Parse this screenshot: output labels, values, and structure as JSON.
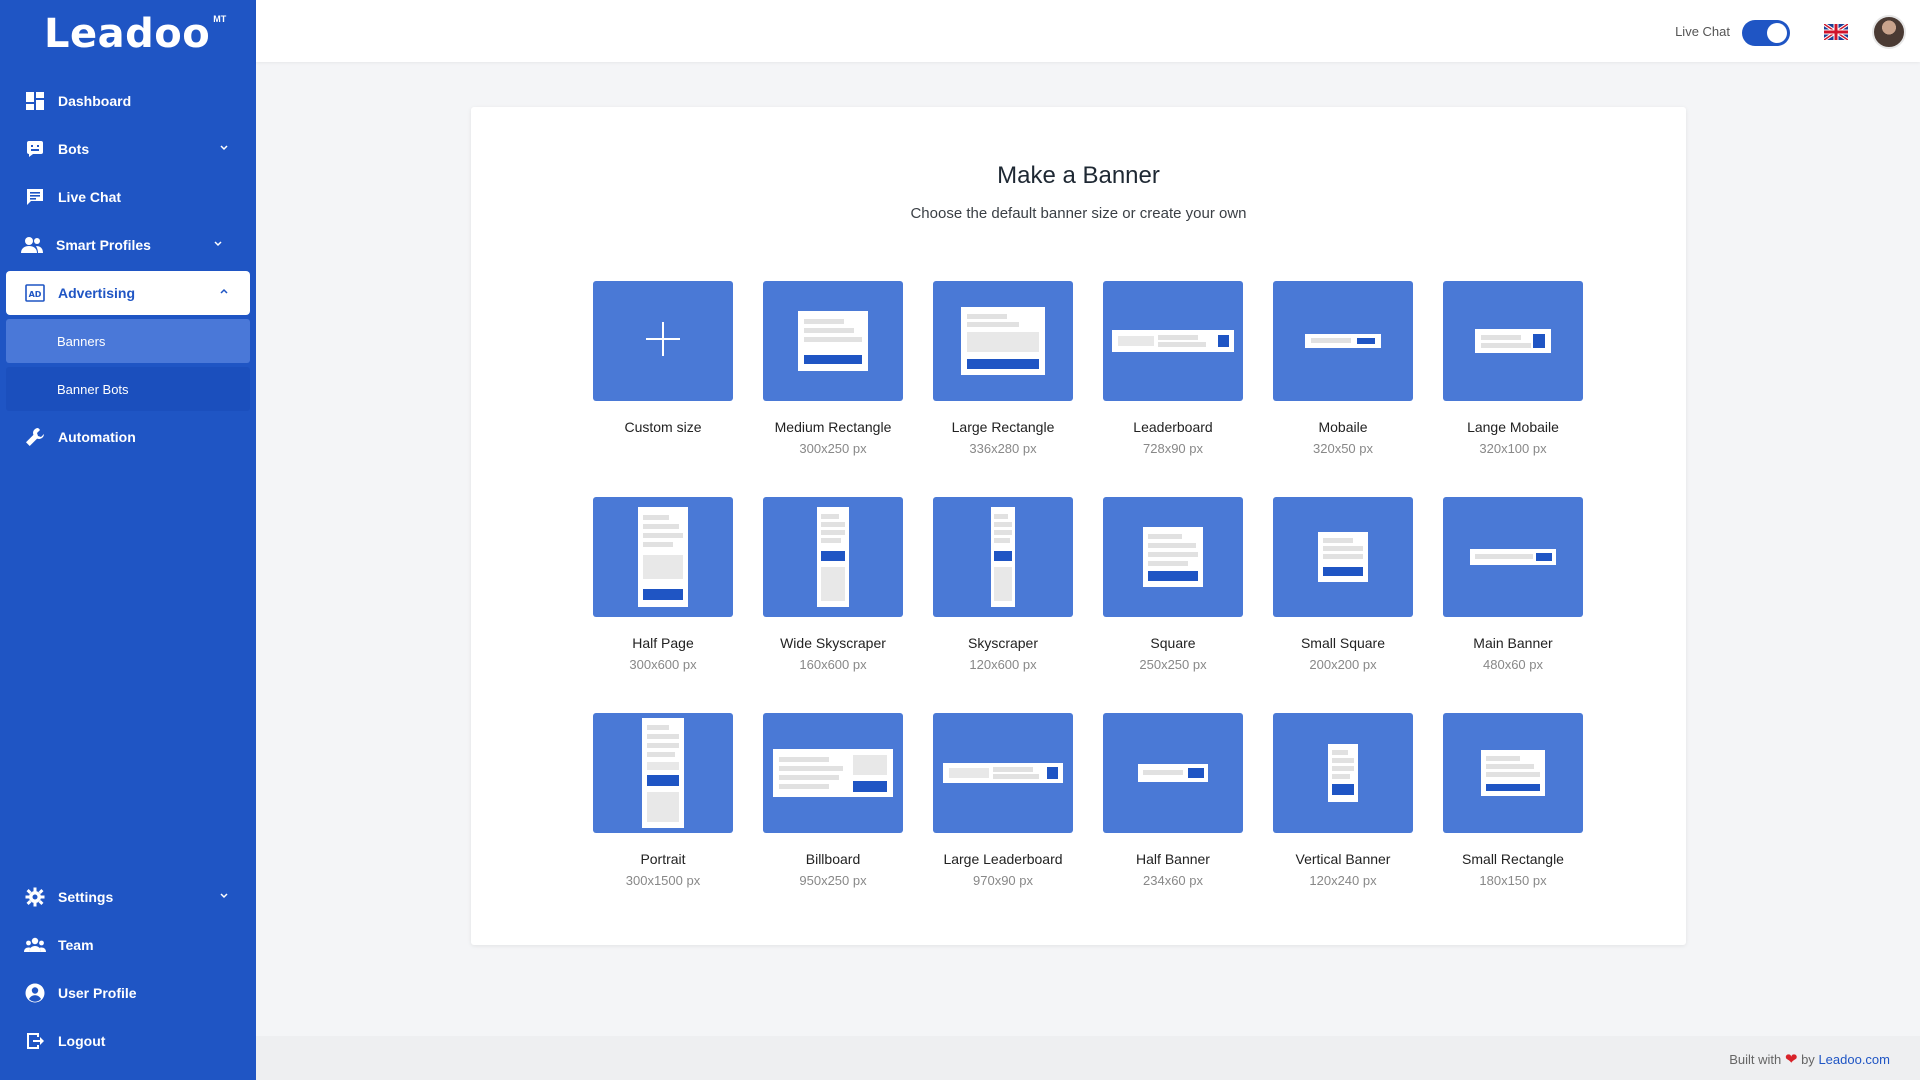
{
  "brand": {
    "logo_text": "Leadoo",
    "logo_mark": "MT"
  },
  "sidebar": {
    "items": [
      {
        "label": "Dashboard"
      },
      {
        "label": "Bots"
      },
      {
        "label": "Live Chat"
      },
      {
        "label": "Smart Profiles"
      },
      {
        "label": "Advertising"
      },
      {
        "label": "Banners"
      },
      {
        "label": "Banner Bots"
      },
      {
        "label": "Automation"
      }
    ],
    "bottom": [
      {
        "label": "Settings"
      },
      {
        "label": "Team"
      },
      {
        "label": "User Profile"
      },
      {
        "label": "Logout"
      }
    ]
  },
  "topbar": {
    "live_chat_label": "Live Chat",
    "live_chat_on": true
  },
  "main": {
    "title": "Make a Banner",
    "subtitle": "Choose the default banner size or create your own",
    "tiles": [
      {
        "name": "Custom size",
        "size": ""
      },
      {
        "name": "Medium Rectangle",
        "size": "300x250 px"
      },
      {
        "name": "Large Rectangle",
        "size": "336x280 px"
      },
      {
        "name": "Leaderboard",
        "size": "728x90 px"
      },
      {
        "name": "Mobaile",
        "size": "320x50 px"
      },
      {
        "name": "Lange Mobaile",
        "size": "320x100 px"
      },
      {
        "name": "Half Page",
        "size": "300x600 px"
      },
      {
        "name": "Wide Skyscraper",
        "size": "160x600 px"
      },
      {
        "name": "Skyscraper",
        "size": "120x600 px"
      },
      {
        "name": "Square",
        "size": "250x250 px"
      },
      {
        "name": "Small Square",
        "size": "200x200 px"
      },
      {
        "name": "Main Banner",
        "size": "480x60 px"
      },
      {
        "name": "Portrait",
        "size": "300x1500 px"
      },
      {
        "name": "Billboard",
        "size": "950x250 px"
      },
      {
        "name": "Large Leaderboard",
        "size": "970x90 px"
      },
      {
        "name": "Half Banner",
        "size": "234x60 px"
      },
      {
        "name": "Vertical Banner",
        "size": "120x240 px"
      },
      {
        "name": "Small Rectangle",
        "size": "180x150 px"
      }
    ]
  },
  "footer": {
    "built_with": "Built with",
    "by": "by",
    "link": "Leadoo.com"
  },
  "colors": {
    "brand": "#1f55c4",
    "tile": "#4a79d6",
    "heart": "#d8232a"
  }
}
